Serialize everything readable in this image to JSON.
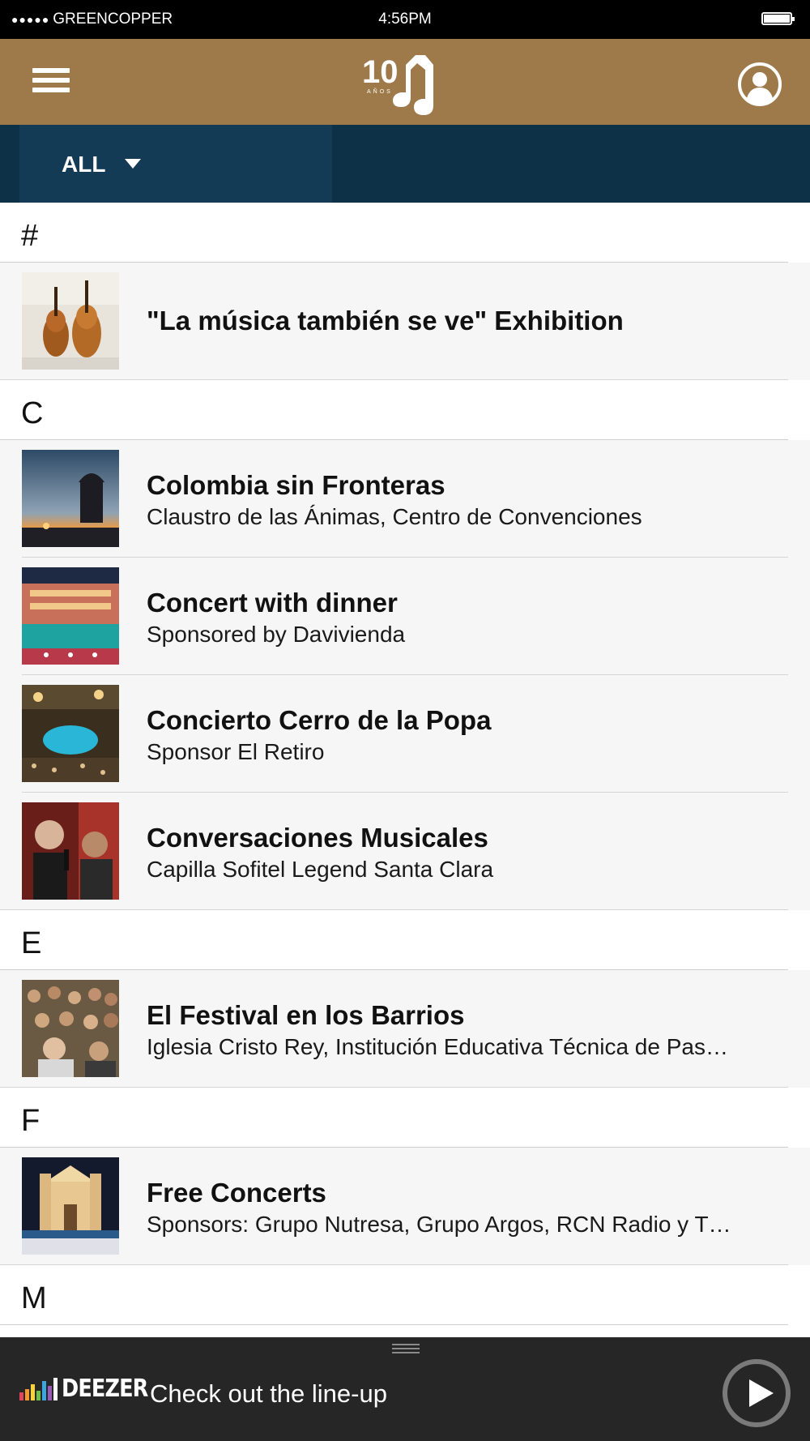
{
  "status_bar": {
    "signal": "●●●●●",
    "carrier": "GREENCOPPER",
    "time": "4:56PM"
  },
  "header": {
    "logo_text": "10",
    "logo_subtext": "AÑOS",
    "menu_icon": "hamburger-icon",
    "profile_icon": "user-circle-icon",
    "brand_color": "#9e7a4a"
  },
  "filter": {
    "label": "ALL",
    "background": "#0d3147"
  },
  "sections": [
    {
      "letter": "#",
      "items": [
        {
          "title": "\"La música también se ve\"  Exhibition",
          "subtitle": ""
        }
      ]
    },
    {
      "letter": "C",
      "items": [
        {
          "title": "Colombia sin Fronteras",
          "subtitle": "Claustro de las Ánimas, Centro de Convenciones"
        },
        {
          "title": "Concert with dinner",
          "subtitle": "Sponsored by Davivienda"
        },
        {
          "title": "Concierto Cerro de la Popa",
          "subtitle": "Sponsor El Retiro"
        },
        {
          "title": "Conversaciones Musicales",
          "subtitle": "Capilla Sofitel Legend Santa Clara"
        }
      ]
    },
    {
      "letter": "E",
      "items": [
        {
          "title": "El Festival en los Barrios",
          "subtitle": "Iglesia Cristo Rey, Institución Educativa Técnica de Pas…"
        }
      ]
    },
    {
      "letter": "F",
      "items": [
        {
          "title": "Free Concerts",
          "subtitle": "Sponsors: Grupo Nutresa, Grupo Argos, RCN Radio y T…"
        }
      ]
    },
    {
      "letter": "M",
      "items": []
    }
  ],
  "player": {
    "brand": "DEEZER",
    "text": "Check out the line-up",
    "play_icon": "play-icon"
  }
}
